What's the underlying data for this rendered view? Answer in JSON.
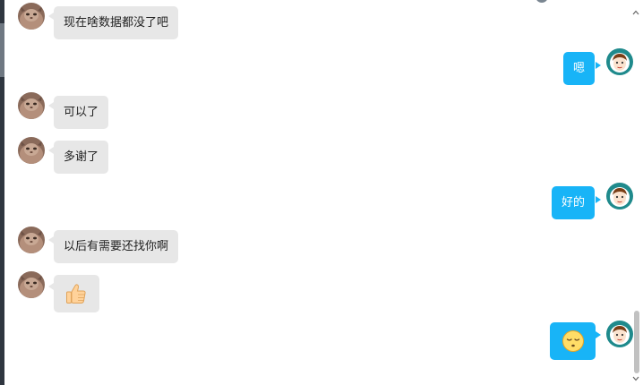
{
  "conversation": {
    "messages": [
      {
        "from": "contact",
        "type": "text",
        "text": "现在啥数据都没了吧"
      },
      {
        "from": "me",
        "type": "text",
        "text": "嗯"
      },
      {
        "from": "contact",
        "type": "text",
        "text": "可以了"
      },
      {
        "from": "contact",
        "type": "text",
        "text": "多谢了"
      },
      {
        "from": "me",
        "type": "text",
        "text": "好的"
      },
      {
        "from": "contact",
        "type": "text",
        "text": "以后有需要还找你啊"
      },
      {
        "from": "contact",
        "type": "emoji",
        "emoji": "thumbs-up"
      },
      {
        "from": "me",
        "type": "emoji",
        "emoji": "relieved-face"
      }
    ]
  },
  "colors": {
    "outgoing_bubble": "#18b4f7",
    "incoming_bubble": "#e7e7e7",
    "background": "#ffffff",
    "scrollbar_thumb": "#c1c1c1"
  },
  "icons": {
    "contact_avatar": "cat-photo-avatar",
    "my_avatar": "cartoon-person-avatar",
    "scroll_up": "chevron-up-icon",
    "scroll_down": "chevron-down-icon"
  }
}
